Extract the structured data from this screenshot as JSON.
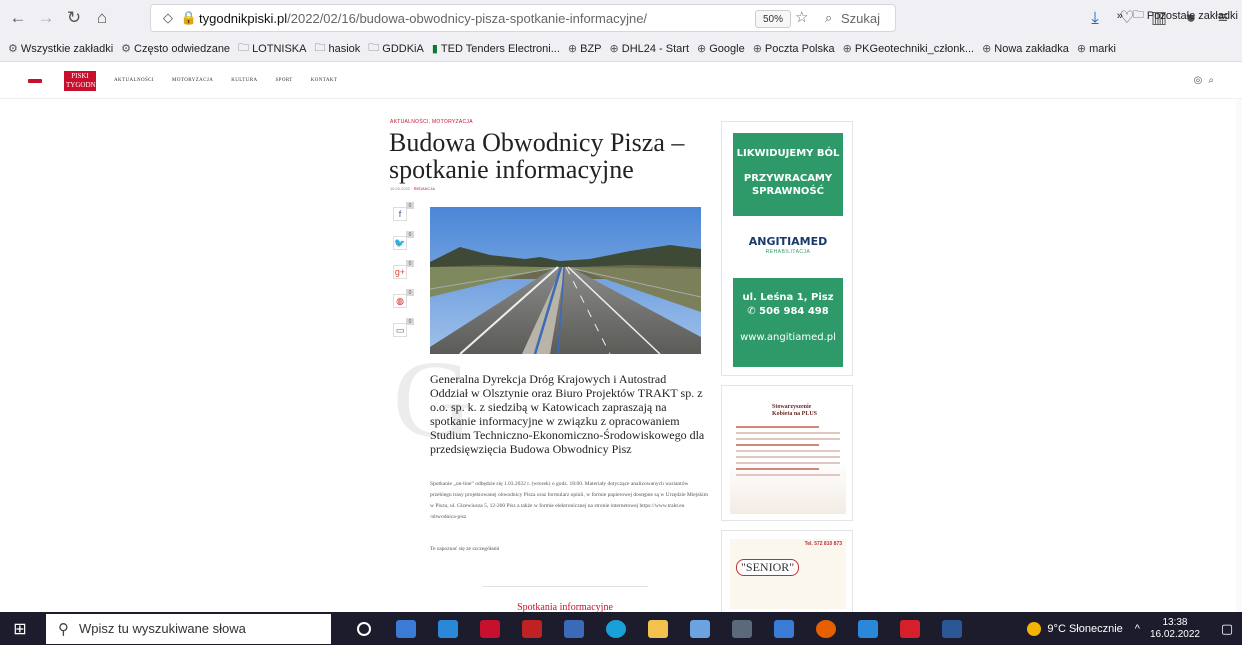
{
  "browser": {
    "url_domain": "tygodnikpiski.pl",
    "url_path": "/2022/02/16/budowa-obwodnicy-pisza-spotkanie-informacyjne/",
    "zoom": "50%",
    "search_placeholder": "Szukaj"
  },
  "bookmarks": [
    {
      "label": "Wszystkie zakładki",
      "icon": "gear-icon"
    },
    {
      "label": "Często odwiedzane",
      "icon": "gear-icon"
    },
    {
      "label": "LOTNISKA",
      "icon": "folder-icon"
    },
    {
      "label": "hasiok",
      "icon": "folder-icon"
    },
    {
      "label": "GDDKiA",
      "icon": "folder-icon"
    },
    {
      "label": "TED Tenders Electroni...",
      "icon": "flag-icon"
    },
    {
      "label": "BZP",
      "icon": "globe-icon"
    },
    {
      "label": "DHL24 - Start",
      "icon": "globe-icon"
    },
    {
      "label": "Google",
      "icon": "globe-icon"
    },
    {
      "label": "Poczta Polska",
      "icon": "globe-icon"
    },
    {
      "label": "PKGeotechniki_członk...",
      "icon": "globe-icon"
    },
    {
      "label": "Nowa zakładka",
      "icon": "globe-icon"
    },
    {
      "label": "marki",
      "icon": "globe-icon"
    }
  ],
  "bookmarks_other": "Pozostałe zakładki",
  "site": {
    "logo_line1": "PISKI",
    "logo_line2": "TYGODNIK",
    "nav": [
      "AKTUALNOŚCI",
      "MOTORYZACJA",
      "KULTURA",
      "SPORT",
      "KONTAKT"
    ]
  },
  "article": {
    "category": "AKTUALNOŚCI, MOTORYZACJA",
    "title": "Budowa Obwodnicy Pisza – spotkanie informacyjne",
    "meta_date": "16.02.2022",
    "meta_author": "REDAKCJA",
    "dropcap": "G",
    "lead": "Generalna Dyrekcja Dróg Krajowych i Autostrad Oddział w Olsztynie oraz Biuro Projektów TRAKT sp. z o.o. sp. k. z siedzibą w Katowicach zapraszają na spotkanie informacyjne w związku z opracowaniem Studium Techniczno-Ekonomiczno-Środowiskowego dla przedsięwzięcia Budowa Obwodnicy Pisz",
    "body": "Spotkanie „on-line” odbędzie się 1.03.2022 r. (wtorek) o godz. 18:00. Materiały dotyczące analizowanych wariantów przebiegu trasy projektowanej obwodnicy Pisza oraz formularz opinii, w formie papierowej dostępne są w Urzędzie Miejskim w Piszu, ul. Gizewiusza 5, 12-200 Pisz a także w formie elektronicznej na stronie internetowej https://www.trakt.eu /obwodnica-pisz",
    "body2": "Te zapoznać się ze szczegółami",
    "related_title": "Spotkania informacyjne"
  },
  "share": [
    {
      "icon": "facebook-icon",
      "glyph": "f",
      "count": "0"
    },
    {
      "icon": "twitter-icon",
      "glyph": "🐦",
      "count": "0"
    },
    {
      "icon": "google-plus-icon",
      "glyph": "g+",
      "count": "0"
    },
    {
      "icon": "pinterest-icon",
      "glyph": "◍",
      "count": "0"
    },
    {
      "icon": "comment-icon",
      "glyph": "▭",
      "count": "0"
    }
  ],
  "ad1": {
    "line1": "LIKWIDUJEMY BÓL",
    "line2": "PRZYWRACAMY SPRAWNOŚĆ",
    "brand": "ANGITIAMED",
    "brand_sub": "REHABILITACJA",
    "address": "ul. Leśna 1, Pisz",
    "phone": "506 984 498",
    "www": "www.angitiamed.pl",
    "green": "#2e9a6a"
  },
  "ad2": {
    "title_l1": "Stowarzyszenie",
    "title_l2": "Kobieta na PLUS"
  },
  "ad3": {
    "name": "\"SENIOR\"",
    "tel": "Tel. 572 810 873"
  },
  "taskbar": {
    "search_placeholder": "Wpisz tu wyszukiwane słowa",
    "weather": "9°C Słonecznie",
    "time": "13:38",
    "date": "16.02.2022"
  }
}
